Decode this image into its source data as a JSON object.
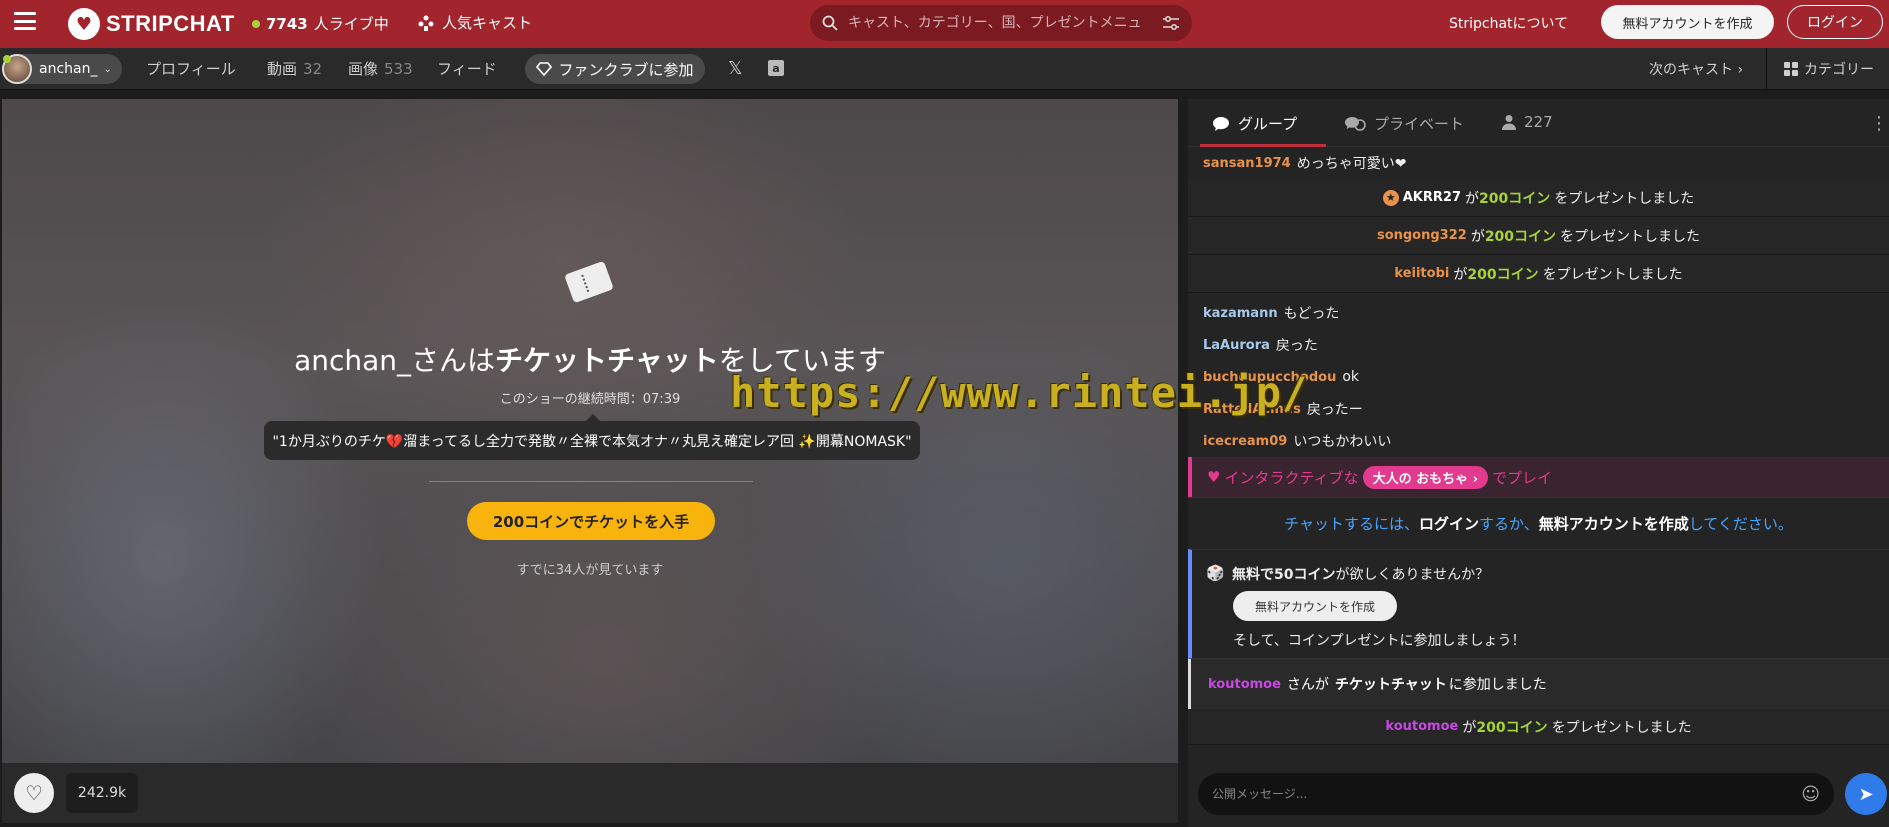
{
  "header": {
    "logo_text": "STRIPCHAT",
    "live_count": "7743",
    "live_suffix": "人ライブ中",
    "popular_label": "人気キャスト",
    "search_placeholder": "キャスト、カテゴリー、国、プレゼントメニュ",
    "about_label": "Stripchatについて",
    "signup_label": "無料アカウントを作成",
    "login_label": "ログイン"
  },
  "subnav": {
    "username": "anchan_",
    "profile_label": "プロフィール",
    "videos_label": "動画",
    "videos_count": "32",
    "images_label": "画像",
    "images_count": "533",
    "feed_label": "フィード",
    "fanclub_label": "ファンクラブに参加",
    "next_cast_label": "次のキャスト",
    "category_label": "カテゴリー"
  },
  "show": {
    "title_prefix": "anchan_さんは",
    "title_bold": "チケットチャット",
    "title_suffix": "をしています",
    "duration": "このショーの継続時間：07:39",
    "description": "\"1か月ぶりのチケ💔溜まってるし全力で発散〃全裸で本気オナ〃丸見え確定レア回 ✨開幕NOMASK\"",
    "buy_label": "200コインでチケットを入手",
    "watching": "すでに34人が見ています",
    "watermark": "https://www.rintei.jp/",
    "likes": "242.9k"
  },
  "chat": {
    "tab_group": "グループ",
    "tab_private": "プライベート",
    "viewers": "227",
    "messages": [
      {
        "user": "sansan1974",
        "text": "めっちゃ可愛い❤",
        "color": "#e8924a"
      }
    ],
    "gifts": [
      {
        "user": "AKRR27",
        "connector": "が",
        "coins": "200コイン",
        "text": "をプレゼントしました",
        "color": "#ffffff"
      },
      {
        "user": "songong322",
        "connector": "が",
        "coins": "200コイン",
        "text": "をプレゼントしました",
        "color": "#e8924a"
      },
      {
        "user": "keiitobi",
        "connector": "が",
        "coins": "200コイン",
        "text": "をプレゼントしました",
        "color": "#e8924a"
      }
    ],
    "messages2": [
      {
        "user": "kazamann",
        "text": "もどった",
        "color": "#a8c8e8"
      },
      {
        "user": "LaAurora",
        "text": "戻った",
        "color": "#a8c8e8"
      },
      {
        "user": "buchoupucchodou",
        "text": "ok",
        "color": "#e8924a"
      },
      {
        "user": "RattedAcinus",
        "text": "戻ったー",
        "color": "#e8924a"
      },
      {
        "user": "icecream09",
        "text": "いつもかわいい",
        "color": "#e8924a"
      }
    ],
    "promo_prefix": "インタラクティブな",
    "promo_tag": "大人の おもちゃ ›",
    "promo_suffix": "でプレイ",
    "login_note_1": "チャットするには、",
    "login_note_login": "ログイン",
    "login_note_2": "するか、",
    "login_note_signup": "無料アカウントを作成",
    "login_note_3": "してください。",
    "bonus_prefix": "無料で50コイン",
    "bonus_suffix": "が欲しくありませんか？",
    "bonus_button": "無料アカウントを作成",
    "bonus_foot": "そして、コインプレゼントに参加しましょう！",
    "joined_user": "koutomoe",
    "joined_mid": "さんが",
    "joined_bold": "チケットチャット",
    "joined_suffix": "に参加しました",
    "last_gift": {
      "user": "koutomoe",
      "connector": "が",
      "coins": "200コイン",
      "text": "をプレゼントしました",
      "color": "#c64ae0"
    },
    "composer_placeholder": "公開メッセージ..."
  },
  "colors": {
    "brand": "#a2252d",
    "coin": "#a6d33a",
    "link": "#4aa3ff",
    "promo": "#e23a8e",
    "buy": "#f8b40c"
  }
}
